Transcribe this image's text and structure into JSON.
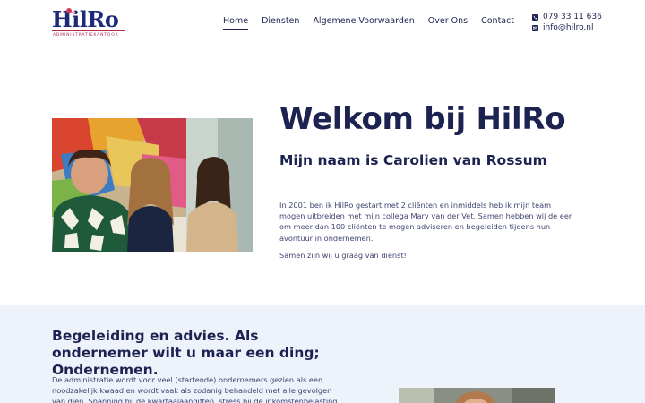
{
  "brand": {
    "name": "HilRo",
    "tagline": "ADMINISTRATIEKANTOOR",
    "primary_color": "#1d2350",
    "accent_color": "#d2385a"
  },
  "nav": {
    "items": [
      {
        "label": "Home",
        "active": true
      },
      {
        "label": "Diensten",
        "active": false
      },
      {
        "label": "Algemene Voorwaarden",
        "active": false
      },
      {
        "label": "Over Ons",
        "active": false
      },
      {
        "label": "Contact",
        "active": false
      }
    ]
  },
  "contact": {
    "phone": "079 33 11 636",
    "phone_icon": "phone-icon",
    "email": "info@hilro.nl",
    "email_icon": "envelope-icon"
  },
  "hero": {
    "title": "Welkom bij HilRo",
    "subtitle": "Mijn naam is Carolien van Rossum",
    "paragraph1": "In 2001 ben ik HilRo gestart met 2 cliënten en inmiddels heb ik mijn team mogen uitbreiden met mijn collega Mary van der Vet. Samen hebben wij de eer om meer dan 100 cliënten te mogen adviseren en begeleiden tijdens hun avontuur in ondernemen.",
    "paragraph2": "Samen zijn wij u graag van dienst!"
  },
  "section2": {
    "title": "Begeleiding en advies. Als ondernemer wilt u maar een ding; Ondernemen.",
    "paragraph": "De administratie wordt voor veel (startende) ondernemers gezien als een noodzakelijk kwaad en wordt vaak als zodanig behandeld met alle gevolgen van dien. Spanning bij de kwartaalaangiften, stress bij de inkomstenbelasting en de"
  }
}
